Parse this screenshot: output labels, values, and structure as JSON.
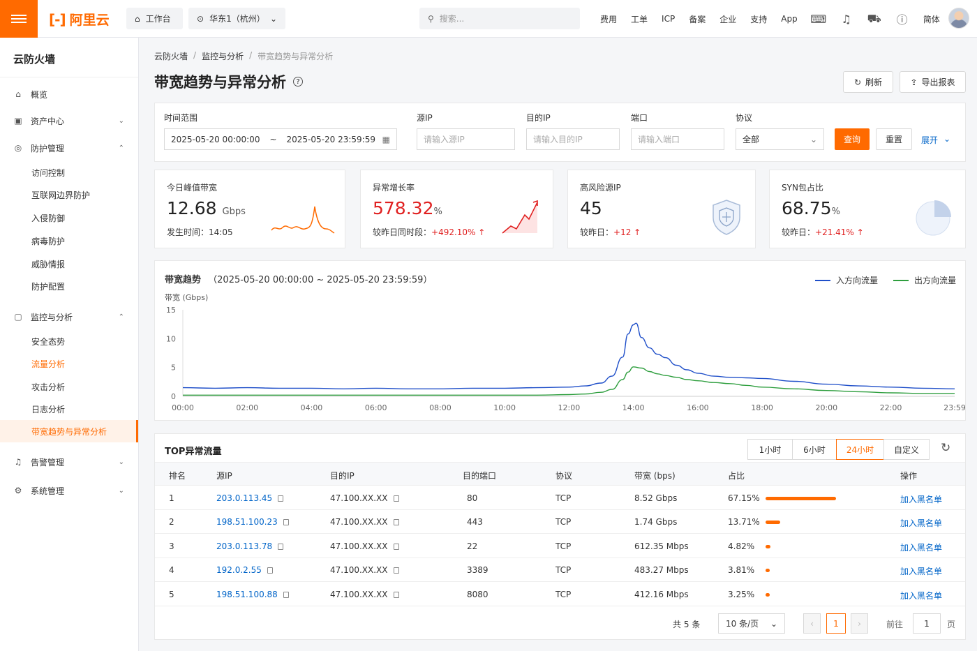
{
  "header": {
    "logo_text": "阿里云",
    "workbench": "工作台",
    "region": "华东1（杭州）",
    "search_placeholder": "搜索...",
    "nav": [
      "费用",
      "工单",
      "ICP",
      "备案",
      "企业",
      "支持",
      "App"
    ],
    "lang": "简体"
  },
  "sidebar": {
    "title": "云防火墙",
    "items": {
      "overview": "概览",
      "assets": "资产中心",
      "protection": "防护管理",
      "access_control": "访问控制",
      "internet_border": "互联网边界防护",
      "intrusion": "入侵防御",
      "virus": "病毒防护",
      "threat_intel": "威胁情报",
      "protect_config": "防护配置",
      "monitor": "监控与分析",
      "security_status": "安全态势",
      "traffic_analysis": "流量分析",
      "attack_analysis": "攻击分析",
      "log_analysis": "日志分析",
      "bandwidth_anomaly": "带宽趋势与异常分析",
      "alarm": "告警管理",
      "system": "系统管理"
    }
  },
  "breadcrumb": [
    "云防火墙",
    "监控与分析",
    "带宽趋势与异常分析"
  ],
  "page_title": "带宽趋势与异常分析",
  "actions": {
    "refresh": "刷新",
    "export": "导出报表"
  },
  "filters": {
    "time_label": "时间范围",
    "time_start": "2025-05-20 00:00:00",
    "time_sep": "~",
    "time_end": "2025-05-20 23:59:59",
    "src_label": "源IP",
    "src_placeholder": "请输入源IP",
    "dst_label": "目的IP",
    "dst_placeholder": "请输入目的IP",
    "port_label": "端口",
    "port_placeholder": "请输入端口",
    "proto_label": "协议",
    "proto_value": "全部",
    "query": "查询",
    "reset": "重置",
    "expand": "展开"
  },
  "kpis": {
    "peak": {
      "title": "今日峰值带宽",
      "value": "12.68",
      "unit": "Gbps",
      "sub_label": "发生时间：",
      "sub_value": "14:05"
    },
    "growth": {
      "title": "异常增长率",
      "value": "578.32",
      "unit": "%",
      "sub_label": "较昨日同时段：",
      "sub_value": "+492.10%"
    },
    "risk_ip": {
      "title": "高风险源IP",
      "value": "45",
      "sub_label": "较昨日：",
      "sub_value": "+12"
    },
    "syn": {
      "title": "SYN包占比",
      "value": "68.75",
      "unit": "%",
      "sub_label": "较昨日：",
      "sub_value": "+21.41%"
    },
    "colors": {
      "accent": "#ff6a00",
      "up": "#e02020"
    }
  },
  "trend": {
    "title": "带宽趋势",
    "range": "（2025-05-20 00:00:00 ~ 2025-05-20 23:59:59）",
    "ylabel": "带宽 (Gbps)",
    "legend_in": "入方向流量",
    "legend_out": "出方向流量"
  },
  "chart_data": {
    "type": "line",
    "title": "带宽趋势",
    "ylabel": "带宽 (Gbps)",
    "ylim": [
      0,
      15
    ],
    "yticks": [
      0,
      5,
      10,
      15
    ],
    "xticks": [
      "00:00",
      "02:00",
      "04:00",
      "06:00",
      "08:00",
      "10:00",
      "12:00",
      "14:00",
      "16:00",
      "18:00",
      "20:00",
      "22:00",
      "23:59"
    ],
    "series": [
      {
        "name": "入方向流量",
        "color": "#1f4fc9",
        "x": [
          "00:00",
          "01:00",
          "02:00",
          "03:00",
          "04:00",
          "05:00",
          "06:00",
          "07:00",
          "08:00",
          "09:00",
          "10:00",
          "11:00",
          "12:00",
          "12:30",
          "13:00",
          "13:20",
          "13:40",
          "13:50",
          "14:00",
          "14:05",
          "14:15",
          "14:30",
          "14:45",
          "15:00",
          "15:20",
          "15:40",
          "16:00",
          "16:30",
          "17:00",
          "17:30",
          "18:00",
          "19:00",
          "20:00",
          "21:00",
          "22:00",
          "23:00",
          "23:59"
        ],
        "values": [
          1.5,
          1.4,
          1.5,
          1.4,
          1.4,
          1.3,
          1.4,
          1.3,
          1.3,
          1.4,
          1.4,
          1.5,
          1.6,
          1.8,
          2.3,
          3.5,
          6.8,
          10.8,
          12.4,
          12.68,
          10.2,
          8.4,
          7.3,
          6.7,
          5.4,
          4.6,
          4.0,
          3.5,
          3.3,
          3.2,
          3.1,
          2.6,
          2.1,
          1.8,
          1.6,
          1.4,
          1.3
        ]
      },
      {
        "name": "出方向流量",
        "color": "#2e9e3e",
        "x": [
          "00:00",
          "01:00",
          "02:00",
          "03:00",
          "04:00",
          "05:00",
          "06:00",
          "07:00",
          "08:00",
          "09:00",
          "10:00",
          "11:00",
          "12:00",
          "12:30",
          "13:00",
          "13:20",
          "13:40",
          "13:50",
          "14:00",
          "14:15",
          "14:30",
          "14:45",
          "15:00",
          "15:20",
          "15:40",
          "16:00",
          "16:30",
          "17:00",
          "17:30",
          "18:00",
          "19:00",
          "20:00",
          "21:00",
          "22:00",
          "23:00",
          "23:59"
        ],
        "values": [
          0.2,
          0.2,
          0.2,
          0.2,
          0.2,
          0.2,
          0.2,
          0.2,
          0.2,
          0.2,
          0.2,
          0.2,
          0.3,
          0.4,
          0.7,
          1.2,
          2.9,
          4.2,
          5.1,
          4.9,
          4.3,
          3.9,
          3.6,
          3.3,
          2.9,
          2.7,
          2.4,
          2.2,
          1.9,
          1.6,
          1.3,
          1.0,
          0.8,
          0.6,
          0.5,
          0.5
        ]
      }
    ]
  },
  "top_table": {
    "title": "TOP异常流量",
    "tabs": [
      "1小时",
      "6小时",
      "24小时",
      "自定义"
    ],
    "active_tab": "24小时",
    "headers": [
      "排名",
      "源IP",
      "目的IP",
      "目的端口",
      "协议",
      "带宽 (bps)",
      "占比",
      "操作"
    ],
    "rows": [
      {
        "rank": "1",
        "src": "203.0.113.45",
        "dst": "47.100.XX.XX",
        "port": "80",
        "proto": "TCP",
        "bw": "8.52 Gbps",
        "pct": "67.15%",
        "pct_value": 67.15,
        "op": "加入黑名单"
      },
      {
        "rank": "2",
        "src": "198.51.100.23",
        "dst": "47.100.XX.XX",
        "port": "443",
        "proto": "TCP",
        "bw": "1.74 Gbps",
        "pct": "13.71%",
        "pct_value": 13.71,
        "op": "加入黑名单"
      },
      {
        "rank": "3",
        "src": "203.0.113.78",
        "dst": "47.100.XX.XX",
        "port": "22",
        "proto": "TCP",
        "bw": "612.35 Mbps",
        "pct": "4.82%",
        "pct_value": 4.82,
        "op": "加入黑名单"
      },
      {
        "rank": "4",
        "src": "192.0.2.55",
        "dst": "47.100.XX.XX",
        "port": "3389",
        "proto": "TCP",
        "bw": "483.27 Mbps",
        "pct": "3.81%",
        "pct_value": 3.81,
        "op": "加入黑名单"
      },
      {
        "rank": "5",
        "src": "198.51.100.88",
        "dst": "47.100.XX.XX",
        "port": "8080",
        "proto": "TCP",
        "bw": "412.16 Mbps",
        "pct": "3.25%",
        "pct_value": 3.25,
        "op": "加入黑名单"
      }
    ],
    "pagination": {
      "total_prefix": "共",
      "total": "5",
      "total_suffix": "条",
      "page_size": "10 条/页",
      "current": "1",
      "goto_label": "前往",
      "goto_value": "1",
      "page_suffix": "页"
    }
  }
}
